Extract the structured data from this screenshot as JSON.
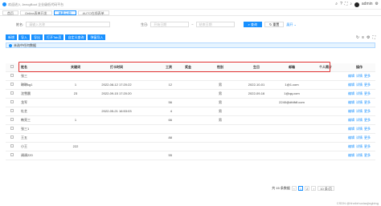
{
  "header": {
    "title": "欢迎进入 JeecgBoot 企业级低代码平台",
    "user": "admin"
  },
  "tabs": [
    {
      "label": "首页",
      "active": false
    },
    {
      "label": "Online表单开发",
      "active": false
    },
    {
      "label": "单表示例",
      "active": true
    },
    {
      "label": "AUTO在线表单",
      "active": false
    }
  ],
  "search": {
    "name_label": "姓名:",
    "name_placeholder": "请输入名称",
    "date_label": "生日:",
    "date_start_placeholder": "开始日期",
    "date_sep": "~",
    "date_end_placeholder": "结束日期",
    "query_label": "查询",
    "reset_label": "重置",
    "expand_label": "展开"
  },
  "toolbar": {
    "buttons": [
      "新增",
      "导入",
      "导出",
      "打开Tab页",
      "自定义查询",
      "弹窗导入"
    ]
  },
  "alert": {
    "text": "未选中任何数据"
  },
  "table": {
    "columns": [
      "",
      "姓名",
      "关键词",
      "打卡时间",
      "工资",
      "奖金",
      "性别",
      "生日",
      "邮箱",
      "个人简介",
      "操作"
    ],
    "rows": [
      [
        "张三",
        "",
        "",
        "",
        "",
        "",
        "",
        "",
        ""
      ],
      [
        "琳琳kg1",
        "1",
        "2022-08-12 17:20:22",
        "12",
        "",
        "男",
        "2022-10-01",
        "1@1.com",
        ""
      ],
      [
        "沈雪晨",
        "23",
        "2022-09-15 17:20:20",
        "",
        "",
        "男",
        "2022-09-16",
        "1@qq.com",
        ""
      ],
      [
        "龙军",
        "",
        "",
        "56",
        "",
        "男",
        "",
        "2240@dfdfdf.com",
        ""
      ],
      [
        "杜艺",
        "",
        "2022-05-21 16:53:03",
        "4",
        "",
        "男",
        "",
        "",
        ""
      ],
      [
        "韩亮三",
        "1",
        "",
        "66",
        "",
        "男",
        "",
        "",
        ""
      ],
      [
        "张三1",
        "",
        "",
        "",
        "",
        "",
        "",
        "",
        ""
      ],
      [
        "王五",
        "",
        "",
        "88",
        "",
        "",
        "",
        "",
        ""
      ],
      [
        "小王",
        "222",
        "",
        "",
        "",
        "",
        "",
        "",
        ""
      ],
      [
        "调调220",
        "",
        "",
        "55",
        "",
        "",
        "",
        "",
        ""
      ]
    ],
    "row_actions": [
      "编辑",
      "详情",
      "更多"
    ]
  },
  "pagination": {
    "total_text": "共 15 条数据",
    "pages": [
      "1",
      "2"
    ],
    "current_page": "1",
    "page_size": "10 条/页"
  },
  "watermark": "CSDN @hhxiixhuxiaojingbing"
}
